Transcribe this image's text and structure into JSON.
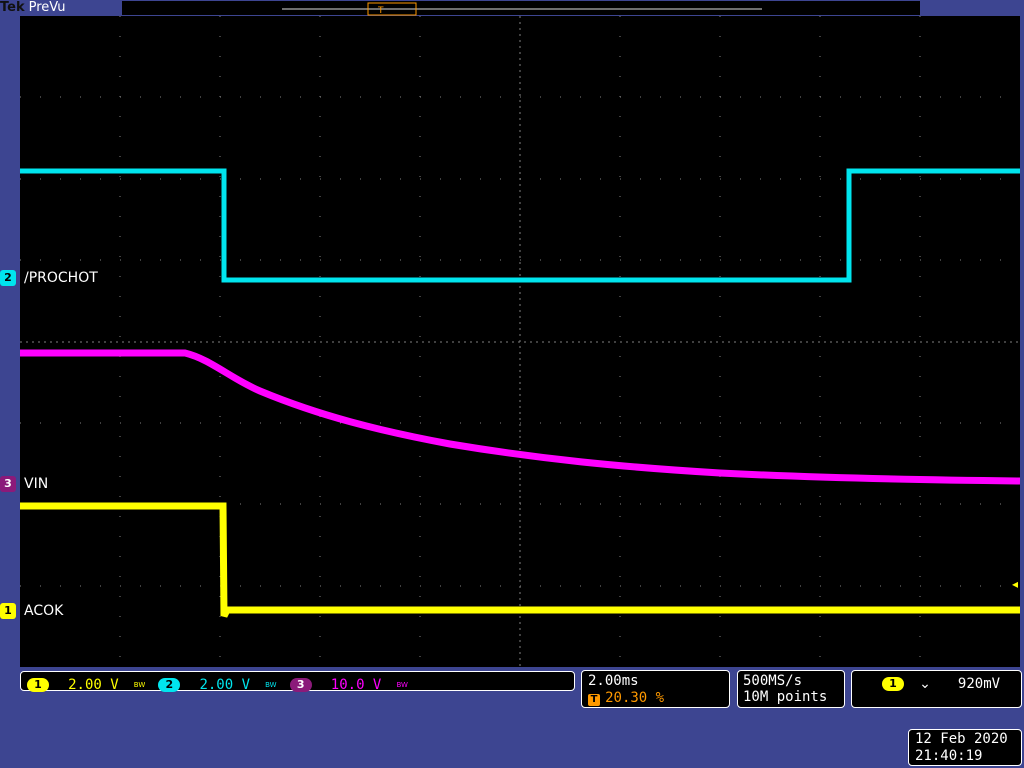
{
  "header": {
    "brand": "Tek",
    "mode": "PreVu"
  },
  "trigger_marker": {
    "label": "T",
    "icon": "trigger-position-icon"
  },
  "channels": [
    {
      "id": "1",
      "name": "ACOK",
      "color": "#ffff00",
      "scale": "2.00 V"
    },
    {
      "id": "2",
      "name": "/PROCHOT",
      "color": "#00e5ee",
      "scale": "2.00 V"
    },
    {
      "id": "3",
      "name": "VIN",
      "color": "#ff00ff",
      "scale": "10.0 V"
    }
  ],
  "bandwidth_icon": "BW",
  "timebase": {
    "scale": "2.00ms",
    "trigger_position": "20.30 %",
    "trigger_badge": "T"
  },
  "acquisition": {
    "sample_rate": "500MS/s",
    "record_length": "10M points"
  },
  "trigger": {
    "source": "1",
    "slope_icon": "falling-edge-icon",
    "slope_glyph": "⌄",
    "level": "920mV"
  },
  "datetime": {
    "date": "12 Feb 2020",
    "time": "21:40:19"
  },
  "colors": {
    "background": "#3d4591",
    "screen": "#000000",
    "grid": "#7f7f7f",
    "trigger": "#ff9900"
  }
}
